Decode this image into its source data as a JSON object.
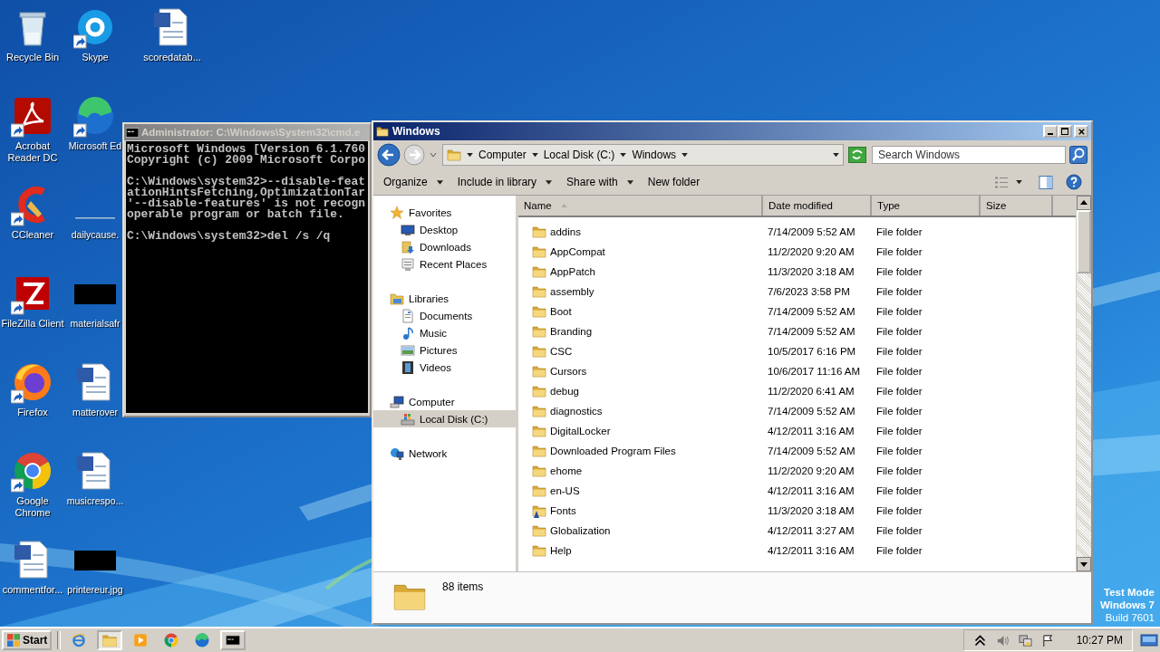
{
  "desktop": {
    "icon_columns": [
      [
        {
          "label": "Recycle Bin",
          "kind": "recycle",
          "shortcut": false
        },
        {
          "label": "Acrobat Reader DC",
          "kind": "acrobat",
          "shortcut": true
        },
        {
          "label": "CCleaner",
          "kind": "ccleaner",
          "shortcut": true
        },
        {
          "label": "FileZilla Client",
          "kind": "filezilla",
          "shortcut": true
        },
        {
          "label": "Firefox",
          "kind": "firefox",
          "shortcut": true
        },
        {
          "label": "Google Chrome",
          "kind": "chrome",
          "shortcut": true
        },
        {
          "label": "commentfor...",
          "kind": "word",
          "shortcut": false
        }
      ],
      [
        {
          "label": "Skype",
          "kind": "skype",
          "shortcut": true
        },
        {
          "label": "Microsoft Ed",
          "kind": "edge",
          "shortcut": true
        },
        {
          "label": "dailycause.",
          "kind": "blank",
          "shortcut": false
        },
        {
          "label": "materialsafr",
          "shortcut": false
        },
        {
          "label": "matterover",
          "kind": "word",
          "shortcut": false
        },
        {
          "label": "musicrespo...",
          "kind": "word",
          "shortcut": false
        },
        {
          "label": "printereur.jpg",
          "shortcut": false
        }
      ],
      [
        {
          "label": "scoredatab...",
          "kind": "word",
          "shortcut": false
        }
      ]
    ],
    "os_notice": [
      "Test Mode",
      "Windows 7",
      "Build 7601"
    ]
  },
  "console_window": {
    "title": "Administrator: C:\\Windows\\System32\\cmd.e",
    "blocks": [
      [
        "Microsoft Windows [Version 6.1.760",
        "Copyright (c) 2009 Microsoft Corpo"
      ],
      [
        "C:\\Windows\\system32>--disable-feat",
        "ationHintsFetching,OptimizationTar",
        "'--disable-features' is not recogn",
        "operable program or batch file."
      ],
      [
        "C:\\Windows\\system32>del /s /q"
      ]
    ]
  },
  "explorer": {
    "title": "Windows",
    "breadcrumb": [
      "Computer",
      "Local Disk (C:)",
      "Windows"
    ],
    "search": {
      "placeholder": "Search Windows"
    },
    "toolbar": [
      {
        "label": "Organize",
        "dropdown": true
      },
      {
        "label": "Include in library",
        "dropdown": true
      },
      {
        "label": "Share with",
        "dropdown": true
      },
      {
        "label": "New folder",
        "dropdown": false
      }
    ],
    "nav": [
      {
        "label": "Favorites",
        "kind": "favorites",
        "selected": false,
        "children": [
          {
            "label": "Desktop",
            "kind": "desktop",
            "selected": false
          },
          {
            "label": "Downloads",
            "kind": "downloads",
            "selected": false
          },
          {
            "label": "Recent Places",
            "kind": "recent",
            "selected": false
          }
        ]
      },
      {
        "label": "Libraries",
        "kind": "libraries",
        "selected": false,
        "children": [
          {
            "label": "Documents",
            "kind": "documents",
            "selected": false
          },
          {
            "label": "Music",
            "kind": "music",
            "selected": false
          },
          {
            "label": "Pictures",
            "kind": "pictures",
            "selected": false
          },
          {
            "label": "Videos",
            "kind": "videos",
            "selected": false
          }
        ]
      },
      {
        "label": "Computer",
        "kind": "computer",
        "selected": false,
        "children": [
          {
            "label": "Local Disk (C:)",
            "kind": "disk",
            "selected": true
          }
        ]
      },
      {
        "label": "Network",
        "kind": "network",
        "selected": false
      }
    ],
    "columns": [
      {
        "label": "Name",
        "sorted": true
      },
      {
        "label": "Date modified",
        "sorted": false
      },
      {
        "label": "Type",
        "sorted": false
      },
      {
        "label": "Size",
        "sorted": false
      }
    ],
    "rows": [
      {
        "name": "addins",
        "date": "7/14/2009 5:52 AM",
        "type": "File folder",
        "kind": "folder"
      },
      {
        "name": "AppCompat",
        "date": "11/2/2020 9:20 AM",
        "type": "File folder",
        "kind": "folder"
      },
      {
        "name": "AppPatch",
        "date": "11/3/2020 3:18 AM",
        "type": "File folder",
        "kind": "folder"
      },
      {
        "name": "assembly",
        "date": "7/6/2023 3:58 PM",
        "type": "File folder",
        "kind": "folder"
      },
      {
        "name": "Boot",
        "date": "7/14/2009 5:52 AM",
        "type": "File folder",
        "kind": "folder"
      },
      {
        "name": "Branding",
        "date": "7/14/2009 5:52 AM",
        "type": "File folder",
        "kind": "folder"
      },
      {
        "name": "CSC",
        "date": "10/5/2017 6:16 PM",
        "type": "File folder",
        "kind": "folder"
      },
      {
        "name": "Cursors",
        "date": "10/6/2017 11:16 AM",
        "type": "File folder",
        "kind": "folder"
      },
      {
        "name": "debug",
        "date": "11/2/2020 6:41 AM",
        "type": "File folder",
        "kind": "folder"
      },
      {
        "name": "diagnostics",
        "date": "7/14/2009 5:52 AM",
        "type": "File folder",
        "kind": "folder"
      },
      {
        "name": "DigitalLocker",
        "date": "4/12/2011 3:16 AM",
        "type": "File folder",
        "kind": "folder"
      },
      {
        "name": "Downloaded Program Files",
        "date": "7/14/2009 5:52 AM",
        "type": "File folder",
        "kind": "folder"
      },
      {
        "name": "ehome",
        "date": "11/2/2020 9:20 AM",
        "type": "File folder",
        "kind": "folder"
      },
      {
        "name": "en-US",
        "date": "4/12/2011 3:16 AM",
        "type": "File folder",
        "kind": "folder"
      },
      {
        "name": "Fonts",
        "date": "11/3/2020 3:18 AM",
        "type": "File folder",
        "kind": "fonts"
      },
      {
        "name": "Globalization",
        "date": "4/12/2011 3:27 AM",
        "type": "File folder",
        "kind": "folder"
      },
      {
        "name": "Help",
        "date": "4/12/2011 3:16 AM",
        "type": "File folder",
        "kind": "folder"
      }
    ],
    "status": "88 items"
  },
  "taskbar": {
    "start": "Start",
    "buttons": [
      {
        "kind": "ie",
        "running": false,
        "selected": false
      },
      {
        "kind": "explorer",
        "running": true,
        "selected": true
      },
      {
        "kind": "media",
        "running": false,
        "selected": false
      },
      {
        "kind": "chrome",
        "running": false,
        "selected": false
      },
      {
        "kind": "edge",
        "running": false,
        "selected": false
      },
      {
        "kind": "cmd",
        "running": true,
        "selected": false
      }
    ],
    "clock": "10:27 PM"
  }
}
